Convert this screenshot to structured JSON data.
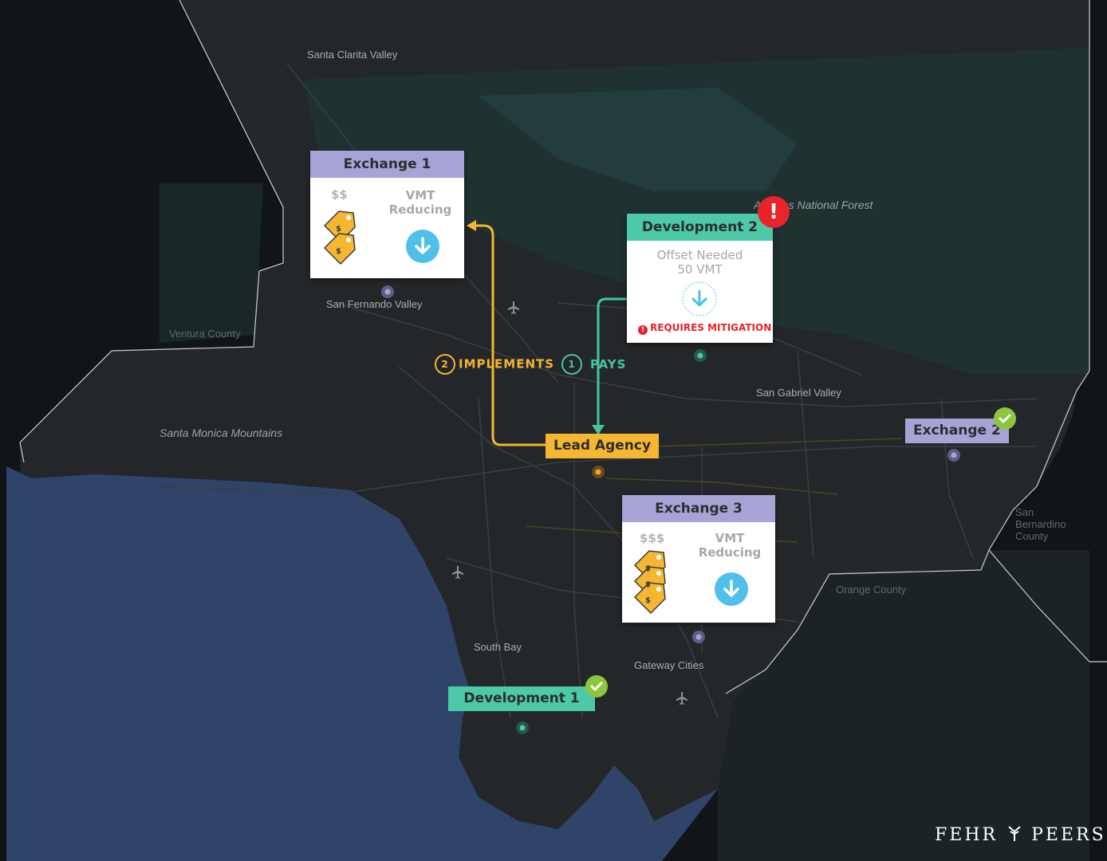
{
  "map": {
    "places": [
      {
        "id": "santa-clarita",
        "label": "Santa Clarita Valley"
      },
      {
        "id": "san-fernando",
        "label": "San Fernando Valley"
      },
      {
        "id": "ventura",
        "label": "Ventura County"
      },
      {
        "id": "santa-monica-mtns",
        "label": "Santa Monica Mountains"
      },
      {
        "id": "national-forest",
        "label": "Angeles National Forest"
      },
      {
        "id": "san-gabriel",
        "label": "San Gabriel Valley"
      },
      {
        "id": "san-bernardino",
        "label": "San Bernardino County"
      },
      {
        "id": "orange-county",
        "label": "Orange County"
      },
      {
        "id": "south-bay",
        "label": "South Bay"
      },
      {
        "id": "gateway-cities",
        "label": "Gateway Cities"
      }
    ]
  },
  "exchange1": {
    "title": "Exchange 1",
    "cost": "$$",
    "benefit": "VMT Reducing"
  },
  "exchange2": {
    "title": "Exchange 2"
  },
  "exchange3": {
    "title": "Exchange 3",
    "cost": "$$$",
    "benefit": "VMT Reducing"
  },
  "development1": {
    "title": "Development 1"
  },
  "development2": {
    "title": "Development 2",
    "offset_line1": "Offset Needed",
    "offset_line2": "50 VMT",
    "alert": "REQUIRES MITIGATION"
  },
  "lead_agency": {
    "title": "Lead Agency"
  },
  "flow": {
    "step1_num": "1",
    "step1_label": "PAYS",
    "step2_num": "2",
    "step2_label": "IMPLEMENTS"
  },
  "brand": {
    "left": "FEHR",
    "right": "PEERS"
  },
  "colors": {
    "exchange": "#a7a3d6",
    "development": "#4cc9a7",
    "lead": "#f5b731",
    "arrow_down": "#4fc0ea",
    "alert": "#e8232a",
    "check": "#8cc63f",
    "ocean": "#2f4468"
  }
}
